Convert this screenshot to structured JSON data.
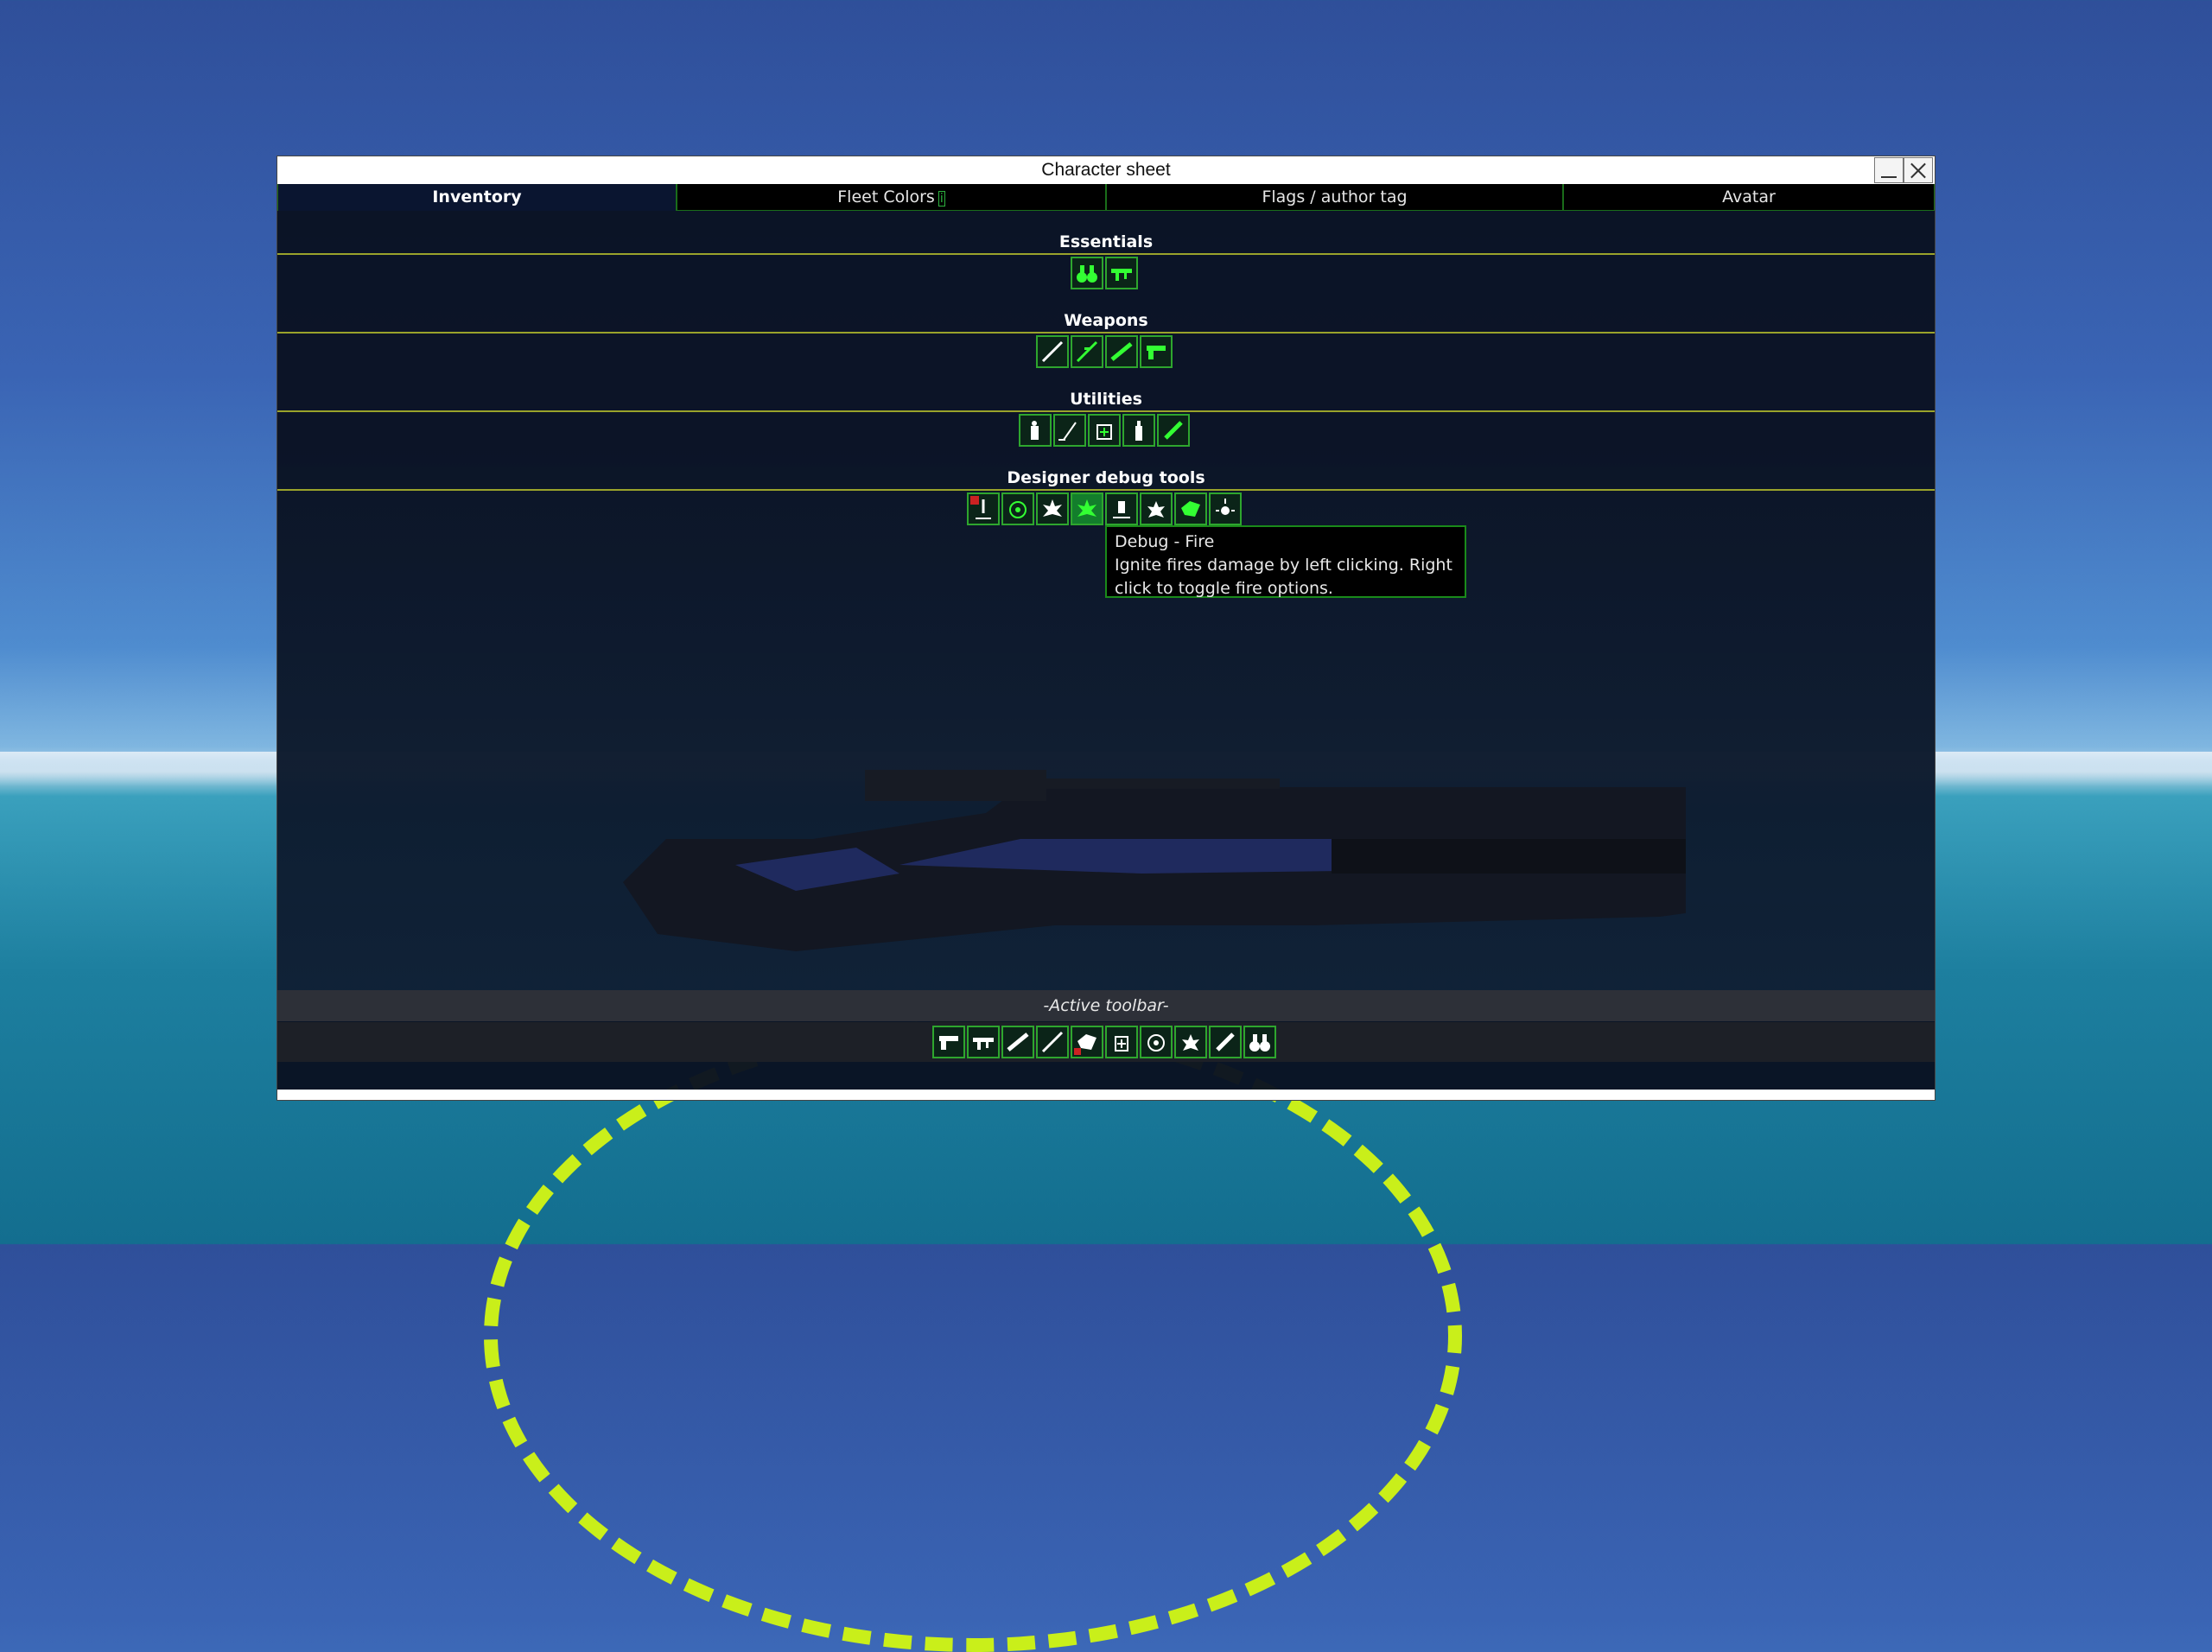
{
  "window": {
    "title": "Character sheet"
  },
  "tabs": [
    {
      "label": "Inventory",
      "active": true
    },
    {
      "label": "Fleet Colors",
      "active": false,
      "badge": "i"
    },
    {
      "label": "Flags / author tag",
      "active": false
    },
    {
      "label": "Avatar",
      "active": false
    }
  ],
  "sections": {
    "essentials": {
      "title": "Essentials",
      "items": [
        "binoculars-icon",
        "machine-gun-icon"
      ]
    },
    "weapons": {
      "title": "Weapons",
      "items": [
        "rifle-white-icon",
        "sniper-rifle-icon",
        "shotgun-icon",
        "pistol-icon"
      ]
    },
    "utilities": {
      "title": "Utilities",
      "items": [
        "fire-extinguisher-icon",
        "wrench-icon",
        "medkit-icon",
        "spray-can-icon",
        "torch-icon"
      ]
    },
    "debug": {
      "title": "Designer debug tools",
      "items": [
        "debug-spawn-icon",
        "debug-target-icon",
        "debug-explosion-icon",
        "debug-fire-icon",
        "debug-flood-icon",
        "debug-blast-icon",
        "debug-grab-icon",
        "debug-sparks-icon"
      ],
      "highlighted_index": 3
    }
  },
  "tooltip": {
    "title": "Debug - Fire",
    "description": "Ignite fires damage by left clicking. Right click to toggle fire options."
  },
  "active_toolbar": {
    "label": "-Active toolbar-",
    "items": [
      "pistol-icon",
      "machine-gun-icon",
      "shotgun-icon",
      "rifle-white-icon",
      "debug-grab-icon",
      "medkit-icon",
      "debug-target-icon",
      "debug-blast-icon",
      "torch-icon",
      "binoculars-icon"
    ]
  },
  "colors": {
    "slot_border": "#2ea62e",
    "slot_highlight": "#137e2c",
    "section_line": "#9aa32b",
    "panel_bg": "#0a1222"
  }
}
